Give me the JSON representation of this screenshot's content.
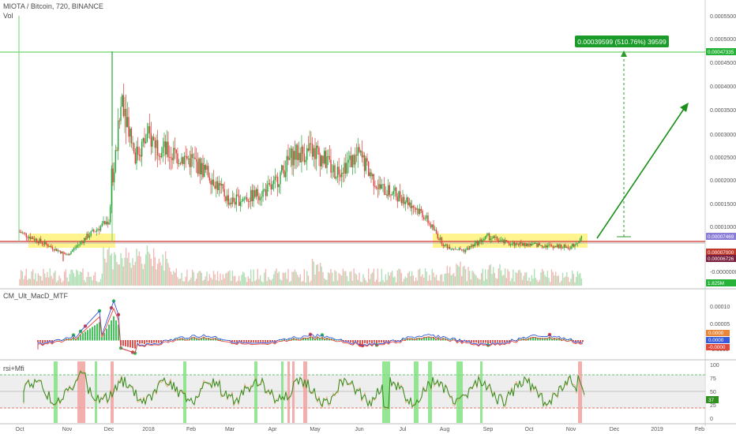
{
  "header": {
    "symbol_line": "MIOTA / Bitcoin, 720, BINANCE",
    "vol_label": "Vol"
  },
  "measure": {
    "text": "0.00039599 (510.76%) 39599",
    "color": "#1b9c2a"
  },
  "colors": {
    "up": "#26a63a",
    "down": "#e0403a",
    "support_zone": "#fff27a",
    "support_line": "#d9534f",
    "arrow": "#1a8f1a",
    "resistance_line": "#6fd36f",
    "macd_line": "#3456d8",
    "signal_line": "#e8453c",
    "rsi_line": "#2f8f1f",
    "mfi_line": "#e8a060",
    "axis_bg": "#ffffff"
  },
  "price_axis": {
    "ticks": [
      "0.00055000",
      "0.00050000",
      "0.00045000",
      "0.00040000",
      "0.00035000",
      "0.00030000",
      "0.00025000",
      "0.00020000",
      "0.00015000",
      "0.00010000",
      "-0.00000000"
    ],
    "badges": [
      {
        "text": "0.00047335",
        "color": "#27b23a"
      },
      {
        "text": "0.00007469",
        "color": "#8a7dd8"
      },
      {
        "text": "0.00007000",
        "color": "#c0392b"
      },
      {
        "text": "0.00006726",
        "color": "#7a1f3d"
      },
      {
        "text": "1.825M",
        "color": "#27b23a"
      }
    ]
  },
  "macd_panel": {
    "label": "CM_Ult_MacD_MTF",
    "ticks": [
      "0.00010",
      "0.00005",
      "0.0000",
      "0.0000",
      "-0.0000"
    ],
    "badges": [
      {
        "text": "0.0000",
        "color": "#e8873a"
      },
      {
        "text": "0.0000",
        "color": "#3a5bd8"
      },
      {
        "text": "-0.0000",
        "color": "#e04a3a"
      }
    ]
  },
  "rsi_panel": {
    "label": "rsi+Mfi",
    "ticks": [
      "100",
      "75",
      "50",
      "25",
      "0"
    ],
    "badge": {
      "text": "37",
      "color": "#2f8f1f"
    }
  },
  "x_axis": {
    "labels": [
      "Oct",
      "Nov",
      "Dec",
      "2018",
      "Feb",
      "Mar",
      "Apr",
      "May",
      "Jun",
      "Jul",
      "Aug",
      "Sep",
      "Oct",
      "Nov",
      "Dec",
      "2019",
      "Feb"
    ]
  },
  "chart_data": {
    "type": "candlestick",
    "title": "MIOTA / Bitcoin, 720, BINANCE",
    "x_labels": [
      "Oct",
      "Nov",
      "Dec",
      "2018",
      "Feb",
      "Mar",
      "Apr",
      "May",
      "Jun",
      "Jul",
      "Aug",
      "Sep",
      "Oct",
      "Nov",
      "Dec",
      "2019",
      "Feb"
    ],
    "y_range": [
      0,
      0.00057
    ],
    "approx_close_series": [
      {
        "x": "Oct",
        "y": 8.5e-05
      },
      {
        "x": "Oct",
        "y": 6.5e-05
      },
      {
        "x": "Nov",
        "y": 3.5e-05
      },
      {
        "x": "Nov",
        "y": 7.5e-05
      },
      {
        "x": "Dec",
        "y": 0.00011
      },
      {
        "x": "Dec",
        "y": 0.00038
      },
      {
        "x": "Dec",
        "y": 0.00025
      },
      {
        "x": "2018",
        "y": 0.00029
      },
      {
        "x": "2018",
        "y": 0.000255
      },
      {
        "x": "Feb",
        "y": 0.00024
      },
      {
        "x": "Feb",
        "y": 0.000205
      },
      {
        "x": "Mar",
        "y": 0.00015
      },
      {
        "x": "Mar",
        "y": 0.00016
      },
      {
        "x": "Apr",
        "y": 0.00018
      },
      {
        "x": "Apr",
        "y": 0.00025
      },
      {
        "x": "May",
        "y": 0.00026
      },
      {
        "x": "May",
        "y": 0.000215
      },
      {
        "x": "Jun",
        "y": 0.00025
      },
      {
        "x": "Jun",
        "y": 0.00018
      },
      {
        "x": "Jul",
        "y": 0.00016
      },
      {
        "x": "Jul",
        "y": 0.000125
      },
      {
        "x": "Aug",
        "y": 5.5e-05
      },
      {
        "x": "Aug",
        "y": 4.5e-05
      },
      {
        "x": "Sep",
        "y": 7.5e-05
      },
      {
        "x": "Sep",
        "y": 6e-05
      },
      {
        "x": "Oct",
        "y": 5.8e-05
      },
      {
        "x": "Oct",
        "y": 5.5e-05
      },
      {
        "x": "Nov",
        "y": 5.2e-05
      }
    ],
    "support_line": 7e-05,
    "resistance_line": 0.00047335,
    "measured_move": {
      "from": 7.47e-05,
      "to": 0.00047335,
      "change": "0.00039599 (510.76%) 39599"
    },
    "rsi_levels": [
      80,
      50,
      20
    ]
  }
}
